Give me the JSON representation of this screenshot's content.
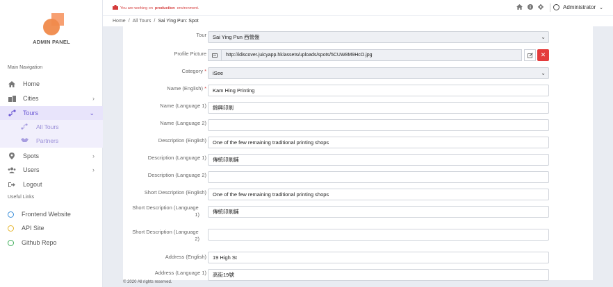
{
  "brand": "ADMIN PANEL",
  "sidebar": {
    "main_label": "Main Navigation",
    "items": [
      {
        "label": "Home",
        "icon": "home-icon"
      },
      {
        "label": "Cities",
        "icon": "building-icon"
      },
      {
        "label": "Tours",
        "icon": "route-icon"
      },
      {
        "label": "All Tours",
        "icon": "route-icon"
      },
      {
        "label": "Partners",
        "icon": "handshake-icon"
      },
      {
        "label": "Spots",
        "icon": "map-pin-icon"
      },
      {
        "label": "Users",
        "icon": "users-icon"
      },
      {
        "label": "Logout",
        "icon": "logout-icon"
      }
    ],
    "links_label": "Useful Links",
    "links": [
      {
        "label": "Frontend Website",
        "color": "#3b8fd9"
      },
      {
        "label": "API Site",
        "color": "#e6b630"
      },
      {
        "label": "Github Repo",
        "color": "#3fae5a"
      }
    ]
  },
  "topbar": {
    "warning_prefix": "You are working on",
    "warning_env": "production",
    "warning_suffix": "environment.",
    "user": "Administrator"
  },
  "breadcrumb": {
    "home": "Home",
    "sep": "/",
    "tours": "All Tours",
    "current": "Sai Ying Pun: Spot"
  },
  "form": {
    "tour_label": "Tour",
    "tour_value": "Sai Ying Pun 西營盤",
    "picture_label": "Profile Picture",
    "picture_value": "http://idiscover.juicyapp.hk/assets/uploads/spots/5CUW8M9HcO.jpg",
    "category_label": "Category",
    "category_value": "iSee",
    "name_en_label": "Name (English)",
    "name_en_value": "Kam Hing Printing",
    "name_l1_label": "Name (Language 1)",
    "name_l1_value": "錦興印刷",
    "name_l2_label": "Name (Language 2)",
    "name_l2_value": "",
    "desc_en_label": "Description (English)",
    "desc_en_value": "One of the few remaining traditional printing shops",
    "desc_l1_label": "Description (Language 1)",
    "desc_l1_value": "傳統印刷鋪",
    "desc_l2_label": "Description (Language 2)",
    "desc_l2_value": "",
    "sdesc_en_label": "Short Description (English)",
    "sdesc_en_value": "One of the few remaining traditional printing shops",
    "sdesc_l1_label_a": "Short Description (Language",
    "sdesc_l1_label_b": "1)",
    "sdesc_l1_value": "傳統印刷鋪",
    "sdesc_l2_label_a": "Short Description (Language",
    "sdesc_l2_label_b": "2)",
    "sdesc_l2_value": "",
    "addr_en_label": "Address (English)",
    "addr_en_value": "19 High St",
    "addr_l1_label": "Address (Language 1)",
    "addr_l1_value": "高街19號"
  },
  "footer": "© 2020 All rights reserved."
}
